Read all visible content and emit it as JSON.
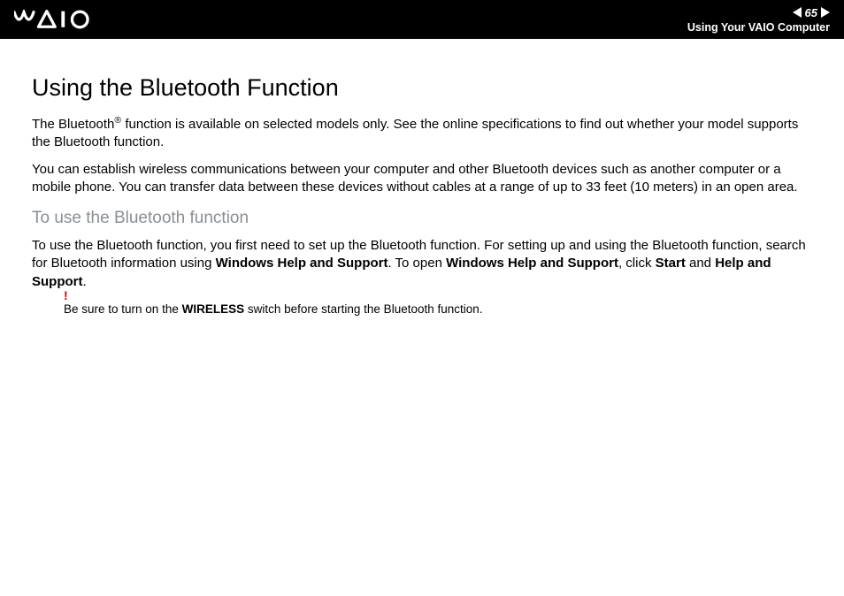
{
  "header": {
    "page_number": "65",
    "breadcrumb": "Using Your VAIO Computer"
  },
  "content": {
    "title": "Using the Bluetooth Function",
    "paragraphs": [
      {
        "pre": "The Bluetooth",
        "sup": "®",
        "post": " function is available on selected models only. See the online specifications to find out whether your model supports the Bluetooth function."
      },
      {
        "text": "You can establish wireless communications between your computer and other Bluetooth devices such as another computer or a mobile phone. You can transfer data between these devices without cables at a range of up to 33 feet (10 meters) in an open area."
      }
    ],
    "subheading": "To use the Bluetooth function",
    "paragraph3": {
      "pre": "To use the Bluetooth function, you first need to set up the Bluetooth function. For setting up and using the Bluetooth function, search for Bluetooth information using ",
      "b1": "Windows Help and Support",
      "mid1": ". To open ",
      "b2": "Windows Help and Support",
      "mid2": ", click ",
      "b3": "Start",
      "mid3": " and ",
      "b4": "Help and Support",
      "post": "."
    },
    "note": {
      "bang": "!",
      "pre": "Be sure to turn on the ",
      "bold": "WIRELESS",
      "post": " switch before starting the Bluetooth function."
    }
  }
}
